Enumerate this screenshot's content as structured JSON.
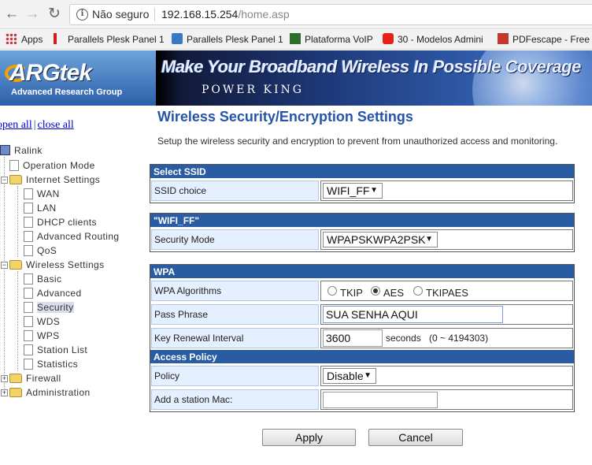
{
  "browser": {
    "security_label": "Não seguro",
    "url_host": "192.168.15.254",
    "url_path": "/home.asp",
    "bookmarks": [
      "Apps",
      "Parallels Plesk Panel 1",
      "Parallels Plesk Panel 1",
      "Plataforma VoIP",
      "30 - Modelos Admini",
      "PDFescape - Free O"
    ]
  },
  "banner": {
    "logo": "ARGtek",
    "logo_sub": "Advanced Research Group",
    "slogan": "Make Your Broadband Wireless In Possible Coverage",
    "tagline": "POWER KING"
  },
  "tree": {
    "open_all": "open all",
    "close_all": "close all",
    "separator": "|",
    "root": "Ralink",
    "items": [
      "Operation Mode",
      "Internet Settings",
      "WAN",
      "LAN",
      "DHCP clients",
      "Advanced Routing",
      "QoS",
      "Wireless Settings",
      "Basic",
      "Advanced",
      "Security",
      "WDS",
      "WPS",
      "Station List",
      "Statistics",
      "Firewall",
      "Administration"
    ]
  },
  "page": {
    "title": "Wireless Security/Encryption Settings",
    "description": "Setup the wireless security and encryption to prevent from unauthorized access and monitoring."
  },
  "select_ssid": {
    "header": "Select SSID",
    "label": "SSID choice",
    "value": "WIFI_FF"
  },
  "ssid_section": {
    "header": "\"WIFI_FF\"",
    "label": "Security Mode",
    "value": "WPAPSKWPA2PSK"
  },
  "wpa": {
    "header": "WPA",
    "algorithms_label": "WPA Algorithms",
    "algorithms": [
      "TKIP",
      "AES",
      "TKIPAES"
    ],
    "selected": "AES",
    "pass_label": "Pass Phrase",
    "pass_value": "SUA SENHA AQUI",
    "renewal_label": "Key Renewal Interval",
    "renewal_value": "3600",
    "renewal_unit": "seconds",
    "renewal_range": "(0 ~ 4194303)"
  },
  "access_policy": {
    "header": "Access Policy",
    "policy_label": "Policy",
    "policy_value": "Disable",
    "mac_label": "Add a station Mac:",
    "mac_value": ""
  },
  "actions": {
    "apply": "Apply",
    "cancel": "Cancel"
  },
  "colors": {
    "header_blue": "#2a5ca3",
    "title_blue": "#2554a8",
    "label_bg": "#e4efff"
  }
}
